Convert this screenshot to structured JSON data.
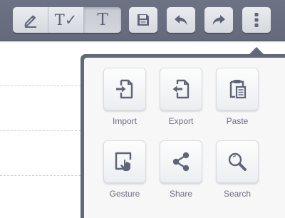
{
  "toolbar": {
    "segments": [
      {
        "icon": "pencil-icon"
      },
      {
        "icon": "text-check-icon",
        "glyph": "T✓"
      },
      {
        "icon": "text-icon",
        "glyph": "T",
        "active": true
      }
    ],
    "buttons": [
      {
        "icon": "save-icon"
      },
      {
        "icon": "undo-icon"
      },
      {
        "icon": "redo-icon"
      },
      {
        "icon": "more-vertical-icon"
      }
    ]
  },
  "menu": {
    "items": [
      {
        "label": "Import",
        "icon": "import-icon"
      },
      {
        "label": "Export",
        "icon": "export-icon"
      },
      {
        "label": "Paste",
        "icon": "paste-icon"
      },
      {
        "label": "Gesture",
        "icon": "gesture-icon"
      },
      {
        "label": "Share",
        "icon": "share-icon"
      },
      {
        "label": "Search",
        "icon": "search-icon"
      }
    ]
  },
  "colors": {
    "toolbar_bg": "#686e7f",
    "button_face": "#e2e4e8",
    "icon": "#5f6577",
    "popover_border": "#62687a",
    "popover_bg": "#f7f7f8",
    "label_text": "#6b7080"
  }
}
